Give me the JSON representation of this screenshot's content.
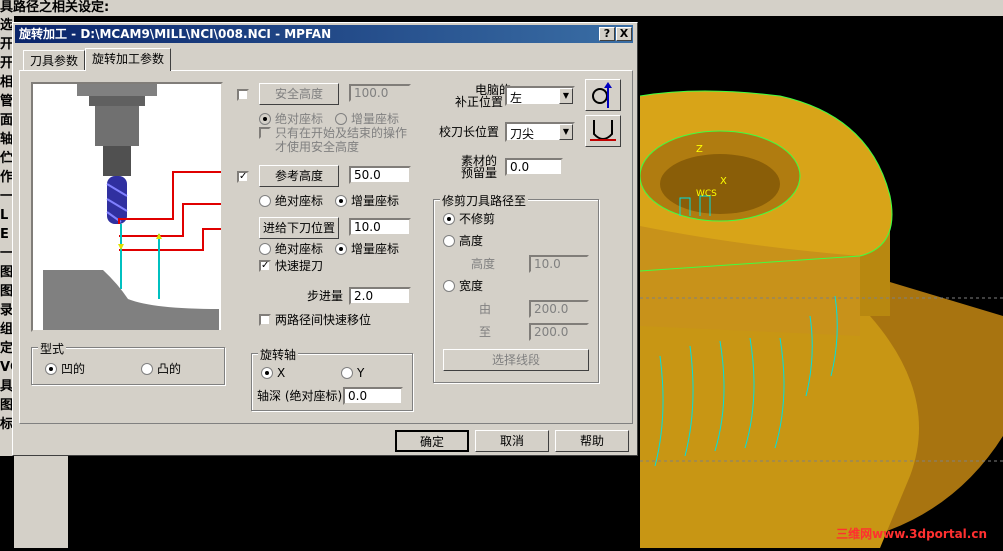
{
  "app": {
    "header_text": "具路径之相关设定:",
    "left_menu": [
      "选",
      "开",
      "开",
      "相",
      "管",
      "面",
      "轴",
      "伫",
      "作",
      "一",
      "L",
      "E",
      "一",
      "图",
      "图",
      "录",
      "组",
      "定",
      "VC",
      "具",
      "图",
      "标"
    ],
    "watermark": "三维网www.3dportal.cn"
  },
  "dialog": {
    "title": "旋转加工 - D:\\MCAM9\\MILL\\NCI\\008.NCI - MPFAN",
    "help_btn": "?",
    "close_btn": "X",
    "tabs": [
      "刀具参数",
      "旋转加工参数"
    ],
    "safe_height": {
      "label": "安全高度",
      "value": "100.0",
      "checked": false
    },
    "safe_abs": "绝对座标",
    "safe_inc": "增量座标",
    "only_start_end": "只有在开始及结束的操作",
    "only_start_end2": "才使用安全高度",
    "ref_height": {
      "label": "参考高度",
      "value": "50.0",
      "checked": true,
      "check_mark": "✓"
    },
    "ref_abs": "绝对座标",
    "ref_inc": "增量座标",
    "feed_plane": {
      "label": "进给下刀位置",
      "value": "10.0"
    },
    "feed_abs": "绝对座标",
    "feed_inc": "增量座标",
    "fast_retract": {
      "label": "快速提刀",
      "checked": true
    },
    "step": {
      "label": "步进量",
      "value": "2.0"
    },
    "fast_move": "两路径间快速移位",
    "comp_label1": "电脑的",
    "comp_label2": "补正位置",
    "comp_value": "左",
    "tip_label": "校刀长位置",
    "tip_value": "刀尖",
    "stock_label1": "素材的",
    "stock_label2": "预留量",
    "stock_value": "0.0",
    "trim_group": "修剪刀具路径至",
    "no_trim": "不修剪",
    "height_opt": "高度",
    "height_label": "高度",
    "height_value": "10.0",
    "width_opt": "宽度",
    "from_label": "由",
    "from_value": "200.0",
    "to_label": "至",
    "to_value": "200.0",
    "select_seg": "选择线段",
    "style_group": "型式",
    "concave": "凹的",
    "convex": "凸的",
    "axis_group": "旋转轴",
    "axis_x": "X",
    "axis_y": "Y",
    "axis_depth_label": "轴深 (绝对座标)",
    "axis_depth_value": "0.0",
    "ok": "确定",
    "cancel": "取消",
    "help": "帮助"
  },
  "colors": {
    "title_start": "#0a246a",
    "title_end": "#3a6ea5",
    "model": "#c89614",
    "toolpath": "#00e0e0",
    "edge": "#40ff40"
  }
}
